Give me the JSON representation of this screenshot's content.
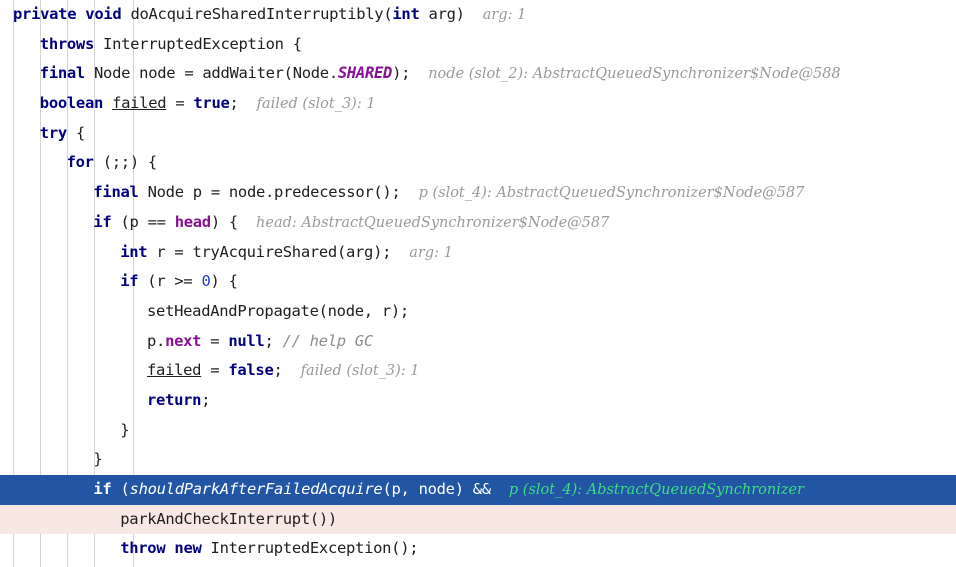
{
  "app": {
    "kind": "code-editor-debugger",
    "language": "Java",
    "theme": "light"
  },
  "colors": {
    "background": "#ffffff",
    "keyword": "#000080",
    "field": "#871094",
    "number": "#2437cf",
    "text": "#202020",
    "comment": "#8c8c8c",
    "inline_hint": "#9a9a9a",
    "inline_hint_selected": "#3ddc84",
    "selection_background": "#2255a4",
    "error_line_background": "#f8e8e4",
    "indent_guide": "#d4d4d4"
  },
  "editor": {
    "indent_guides_x": [
      13,
      40,
      67,
      94,
      133
    ],
    "line_height": 29.7,
    "lines": [
      {
        "id": "line-1",
        "indent": 0,
        "state": "normal",
        "tokens": [
          {
            "t": "private",
            "c": "kw"
          },
          {
            "t": " ",
            "c": "plain"
          },
          {
            "t": "void",
            "c": "kw"
          },
          {
            "t": " doAcquireSharedInterruptibly(",
            "c": "plain"
          },
          {
            "t": "int",
            "c": "kw"
          },
          {
            "t": " arg)",
            "c": "plain"
          }
        ],
        "hint": "arg: 1"
      },
      {
        "id": "line-2",
        "indent": 1,
        "state": "normal",
        "tokens": [
          {
            "t": "throws",
            "c": "kw"
          },
          {
            "t": " InterruptedException {",
            "c": "plain"
          }
        ],
        "hint": ""
      },
      {
        "id": "line-3",
        "indent": 1,
        "state": "normal",
        "tokens": [
          {
            "t": "final",
            "c": "kw"
          },
          {
            "t": " Node node = addWaiter(Node.",
            "c": "plain"
          },
          {
            "t": "SHARED",
            "c": "fldi"
          },
          {
            "t": ");",
            "c": "plain"
          }
        ],
        "hint": "node (slot_2): AbstractQueuedSynchronizer$Node@588"
      },
      {
        "id": "line-4",
        "indent": 1,
        "state": "normal",
        "tokens": [
          {
            "t": "boolean",
            "c": "kw"
          },
          {
            "t": " ",
            "c": "plain"
          },
          {
            "t": "failed",
            "c": "und"
          },
          {
            "t": " = ",
            "c": "plain"
          },
          {
            "t": "true",
            "c": "kw"
          },
          {
            "t": ";",
            "c": "plain"
          }
        ],
        "hint": "failed (slot_3): 1"
      },
      {
        "id": "line-5",
        "indent": 1,
        "state": "normal",
        "tokens": [
          {
            "t": "try",
            "c": "kw"
          },
          {
            "t": " {",
            "c": "plain"
          }
        ],
        "hint": ""
      },
      {
        "id": "line-6",
        "indent": 2,
        "state": "normal",
        "tokens": [
          {
            "t": "for",
            "c": "kw"
          },
          {
            "t": " (;;) {",
            "c": "plain"
          }
        ],
        "hint": ""
      },
      {
        "id": "line-7",
        "indent": 3,
        "state": "normal",
        "tokens": [
          {
            "t": "final",
            "c": "kw"
          },
          {
            "t": " Node p = node.predecessor();",
            "c": "plain"
          }
        ],
        "hint": "p (slot_4): AbstractQueuedSynchronizer$Node@587"
      },
      {
        "id": "line-8",
        "indent": 3,
        "state": "normal",
        "tokens": [
          {
            "t": "if",
            "c": "kw"
          },
          {
            "t": " (p == ",
            "c": "plain"
          },
          {
            "t": "head",
            "c": "fld"
          },
          {
            "t": ") {",
            "c": "plain"
          }
        ],
        "hint": "head: AbstractQueuedSynchronizer$Node@587"
      },
      {
        "id": "line-9",
        "indent": 4,
        "state": "normal",
        "tokens": [
          {
            "t": "int",
            "c": "kw"
          },
          {
            "t": " r = tryAcquireShared(arg);",
            "c": "plain"
          }
        ],
        "hint": "arg: 1"
      },
      {
        "id": "line-10",
        "indent": 4,
        "state": "normal",
        "tokens": [
          {
            "t": "if",
            "c": "kw"
          },
          {
            "t": " (r >= ",
            "c": "plain"
          },
          {
            "t": "0",
            "c": "num"
          },
          {
            "t": ") {",
            "c": "plain"
          }
        ],
        "hint": ""
      },
      {
        "id": "line-11",
        "indent": 5,
        "state": "normal",
        "tokens": [
          {
            "t": "setHeadAndPropagate(node, r);",
            "c": "plain"
          }
        ],
        "hint": ""
      },
      {
        "id": "line-12",
        "indent": 5,
        "state": "normal",
        "tokens": [
          {
            "t": "p.",
            "c": "plain"
          },
          {
            "t": "next",
            "c": "fld"
          },
          {
            "t": " = ",
            "c": "plain"
          },
          {
            "t": "null",
            "c": "kw"
          },
          {
            "t": ";",
            "c": "plain"
          },
          {
            "t": " // help GC",
            "c": "cmt"
          }
        ],
        "hint": ""
      },
      {
        "id": "line-13",
        "indent": 5,
        "state": "normal",
        "tokens": [
          {
            "t": "failed",
            "c": "und"
          },
          {
            "t": " = ",
            "c": "plain"
          },
          {
            "t": "false",
            "c": "kw"
          },
          {
            "t": ";",
            "c": "plain"
          }
        ],
        "hint": "failed (slot_3): 1"
      },
      {
        "id": "line-14",
        "indent": 5,
        "state": "normal",
        "tokens": [
          {
            "t": "return",
            "c": "kw"
          },
          {
            "t": ";",
            "c": "plain"
          }
        ],
        "hint": ""
      },
      {
        "id": "line-15",
        "indent": 4,
        "state": "normal",
        "tokens": [
          {
            "t": "}",
            "c": "plain"
          }
        ],
        "hint": ""
      },
      {
        "id": "line-16",
        "indent": 3,
        "state": "normal",
        "tokens": [
          {
            "t": "}",
            "c": "plain"
          }
        ],
        "hint": ""
      },
      {
        "id": "line-17",
        "indent": 3,
        "state": "selected",
        "tokens": [
          {
            "t": "if",
            "c": "kw"
          },
          {
            "t": " (",
            "c": "plain"
          },
          {
            "t": "shouldParkAfterFailedAcquire",
            "c": "stat"
          },
          {
            "t": "(p, node) &&",
            "c": "plain"
          }
        ],
        "hint": "p (slot_4): AbstractQueuedSynchronizer"
      },
      {
        "id": "line-18",
        "indent": 4,
        "state": "error",
        "tokens": [
          {
            "t": "parkAndCheckInterrupt())",
            "c": "plain"
          }
        ],
        "hint": ""
      },
      {
        "id": "line-19",
        "indent": 4,
        "state": "normal",
        "tokens": [
          {
            "t": "throw",
            "c": "kw"
          },
          {
            "t": " ",
            "c": "plain"
          },
          {
            "t": "new",
            "c": "kw"
          },
          {
            "t": " InterruptedException();",
            "c": "plain"
          }
        ],
        "hint": ""
      }
    ]
  }
}
